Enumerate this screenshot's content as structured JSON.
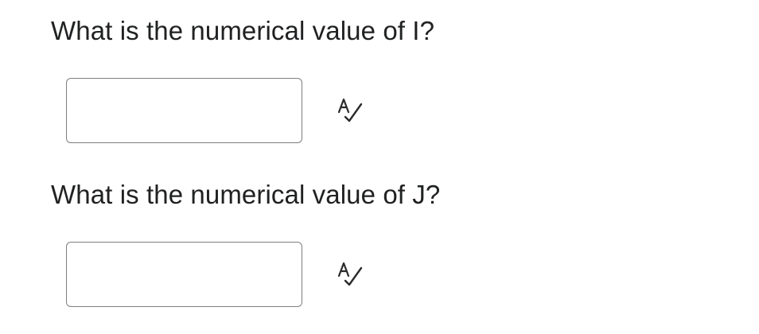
{
  "questions": [
    {
      "prompt": "What is the numerical value of I?",
      "answer_value": "",
      "spellcheck_icon": "spellcheck-icon"
    },
    {
      "prompt": "What is the numerical value of J?",
      "answer_value": "",
      "spellcheck_icon": "spellcheck-icon"
    }
  ],
  "colors": {
    "text": "#202122",
    "input_border": "#7c7e80",
    "icon": "#2b2b2b"
  }
}
